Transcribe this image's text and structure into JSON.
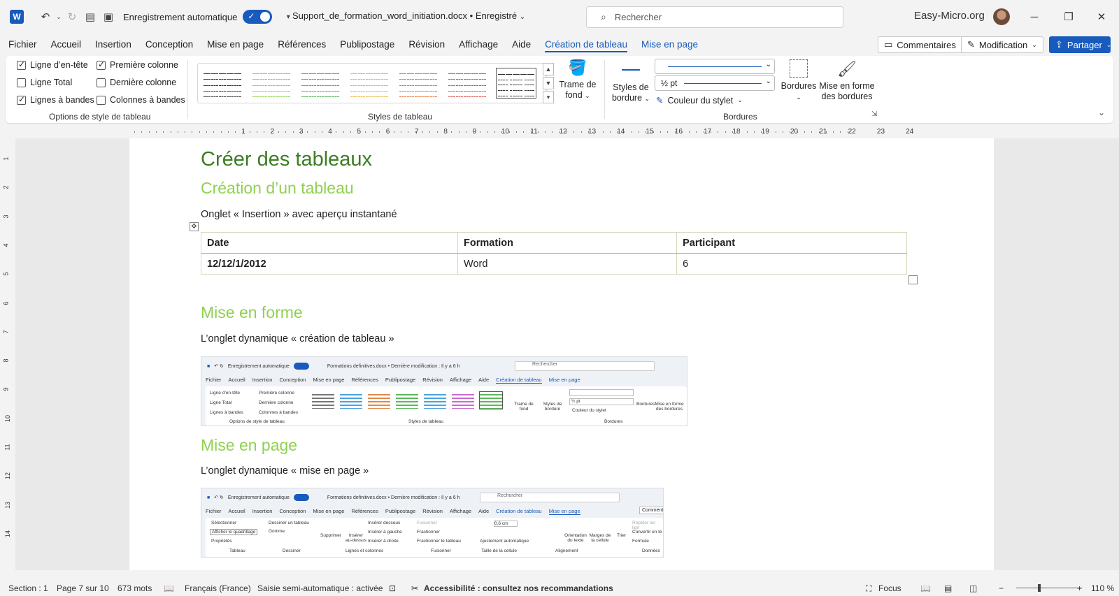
{
  "titlebar": {
    "app_icon": "W",
    "autosave_label": "Enregistrement automatique",
    "document_title": "Support_de_formation_word_initiation.docx • Enregistré",
    "search_placeholder": "Rechercher",
    "account_name": "Easy-Micro.org"
  },
  "menu": {
    "items": [
      "Fichier",
      "Accueil",
      "Insertion",
      "Conception",
      "Mise en page",
      "Références",
      "Publipostage",
      "Révision",
      "Affichage",
      "Aide"
    ],
    "context_tabs": [
      "Création de tableau",
      "Mise en page"
    ],
    "comments": "Commentaires",
    "editing": "Modification",
    "share": "Partager"
  },
  "ribbon": {
    "style_options": {
      "label": "Options de style de tableau",
      "items": [
        {
          "label": "Ligne d’en-tête",
          "checked": true
        },
        {
          "label": "Première colonne",
          "checked": true
        },
        {
          "label": "Ligne Total",
          "checked": false
        },
        {
          "label": "Dernière colonne",
          "checked": false
        },
        {
          "label": "Lignes à bandes",
          "checked": true
        },
        {
          "label": "Colonnes à bandes",
          "checked": false
        }
      ]
    },
    "table_styles": {
      "label": "Styles de tableau",
      "swatch_colors": [
        "#333333",
        "#8fd14f",
        "#4caf50",
        "#f0b43c",
        "#e07a3a",
        "#d9534f",
        "#333333"
      ],
      "shading": "Trame de fond"
    },
    "borders": {
      "label": "Bordures",
      "border_styles": "Styles de bordure",
      "weight": "½ pt",
      "pen_color": "Couleur du stylet",
      "borders": "Bordures",
      "border_painter_line1": "Mise en forme",
      "border_painter_line2": "des bordures"
    }
  },
  "ruler": {
    "h_numbers": [
      "1",
      "2",
      "3",
      "4",
      "5",
      "6",
      "7",
      "8",
      "9",
      "10",
      "11",
      "12",
      "13",
      "14",
      "15",
      "16",
      "17",
      "18",
      "19",
      "20",
      "21",
      "22",
      "23",
      "24"
    ],
    "v_numbers": [
      "1",
      "2",
      "3",
      "4",
      "5",
      "6",
      "7",
      "8",
      "9",
      "10",
      "11",
      "12",
      "13",
      "14"
    ]
  },
  "document": {
    "heading1": "Créer des tableaux",
    "section1_title": "Création d’un tableau",
    "section1_text": "Onglet « Insertion » avec aperçu instantané",
    "table": {
      "headers": [
        "Date",
        "Formation",
        "Participant"
      ],
      "rows": [
        [
          "12/12/1/2012",
          "Word",
          "6"
        ]
      ]
    },
    "section2_title": "Mise en forme",
    "section2_text": "L’onglet dynamique « création de tableau »",
    "section3_title": "Mise en page",
    "section3_text": "L’onglet dynamique « mise en page »",
    "shot1": {
      "autosave": "Enregistrement automatique",
      "title": "Formations definitives.docx  •  Dernière modification : Il y a 6 h",
      "search": "Rechercher",
      "tabs": [
        "Fichier",
        "Accueil",
        "Insertion",
        "Conception",
        "Mise en page",
        "Références",
        "Publipostage",
        "Révision",
        "Affichage",
        "Aide",
        "Création de tableau",
        "Mise en page"
      ],
      "opt1": "Ligne d’en-tête",
      "opt2": "Première colonne",
      "opt3": "Ligne Total",
      "opt4": "Dernière colonne",
      "opt5": "Lignes à bandes",
      "opt6": "Colonnes à bandes",
      "group1": "Options de style de tableau",
      "group2": "Styles de tableau",
      "group3": "Bordures",
      "shading": "Trame de fond",
      "styles_border": "Styles de bordure",
      "weight": "½ pt",
      "pen": "Couleur du stylet",
      "borders": "Bordures",
      "painter": "Mise en forme des bordures"
    },
    "shot2": {
      "autosave": "Enregistrement automatique",
      "title": "Formations definitives.docx  •  Dernière modification : Il y a 6 h",
      "search": "Rechercher",
      "comment": "Comment",
      "tabs": [
        "Fichier",
        "Accueil",
        "Insertion",
        "Conception",
        "Mise en page",
        "Références",
        "Publipostage",
        "Révision",
        "Affichage",
        "Aide",
        "Création de tableau",
        "Mise en page"
      ],
      "select": "Sélectionner",
      "gridlines": "Afficher le quadrillage",
      "properties": "Propriétés",
      "draw_table": "Dessiner un tableau",
      "eraser": "Gomme",
      "delete": "Supprimer",
      "insert_above": "Insérer au-dessus",
      "insert_below": "Insérer dessous",
      "insert_left": "Insérer à gauche",
      "insert_right": "Insérer à droite",
      "merge": "Fusionner",
      "split": "Fractionner",
      "split_table": "Fractionner le tableau",
      "height": "0,6 cm",
      "autofit": "Ajustement automatique",
      "direction": "Orientation du texte",
      "margins": "Marges de la cellule",
      "sort": "Trier",
      "repeat": "Répéter les lign",
      "convert": "Convertir en te",
      "formula": "Formule",
      "g1": "Tableau",
      "g2": "Dessiner",
      "g3": "Lignes et colonnes",
      "g4": "Fusionner",
      "g5": "Taille de la cellule",
      "g6": "Alignement",
      "g7": "Données"
    }
  },
  "statusbar": {
    "section": "Section : 1",
    "page": "Page 7 sur 10",
    "words": "673 mots",
    "language": "Français (France)",
    "autocomplete": "Saisie semi-automatique : activée",
    "accessibility": "Accessibilité : consultez nos recommandations",
    "focus": "Focus",
    "zoom": "110 %"
  }
}
